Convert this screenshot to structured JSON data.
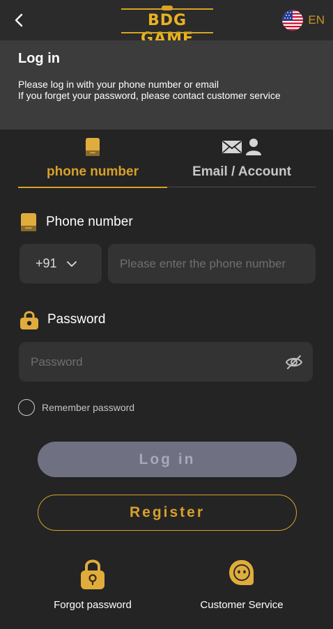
{
  "header": {
    "logo_text": "BDG GAME",
    "language": "EN"
  },
  "intro": {
    "title": "Log in",
    "line1": "Please log in with your phone number or email",
    "line2": "If you forget your password, please contact customer service"
  },
  "tabs": [
    {
      "label": "phone number",
      "active": true,
      "icon": "phone-icon"
    },
    {
      "label": "Email / Account",
      "active": false,
      "icon": "email-user-icon"
    }
  ],
  "phone_field": {
    "label": "Phone number",
    "country_code": "+91",
    "placeholder": "Please enter the phone number",
    "value": ""
  },
  "password_field": {
    "label": "Password",
    "placeholder": "Password",
    "value": ""
  },
  "remember": {
    "label": "Remember password",
    "checked": false
  },
  "buttons": {
    "login": "Log in",
    "register": "Register"
  },
  "bottom_links": {
    "forgot": "Forgot password",
    "service": "Customer Service"
  },
  "colors": {
    "accent_gold": "#d8a12a",
    "background": "#242424",
    "intro_background": "#3c3c3c",
    "input_background": "#333333",
    "login_disabled": "#6f7182"
  }
}
